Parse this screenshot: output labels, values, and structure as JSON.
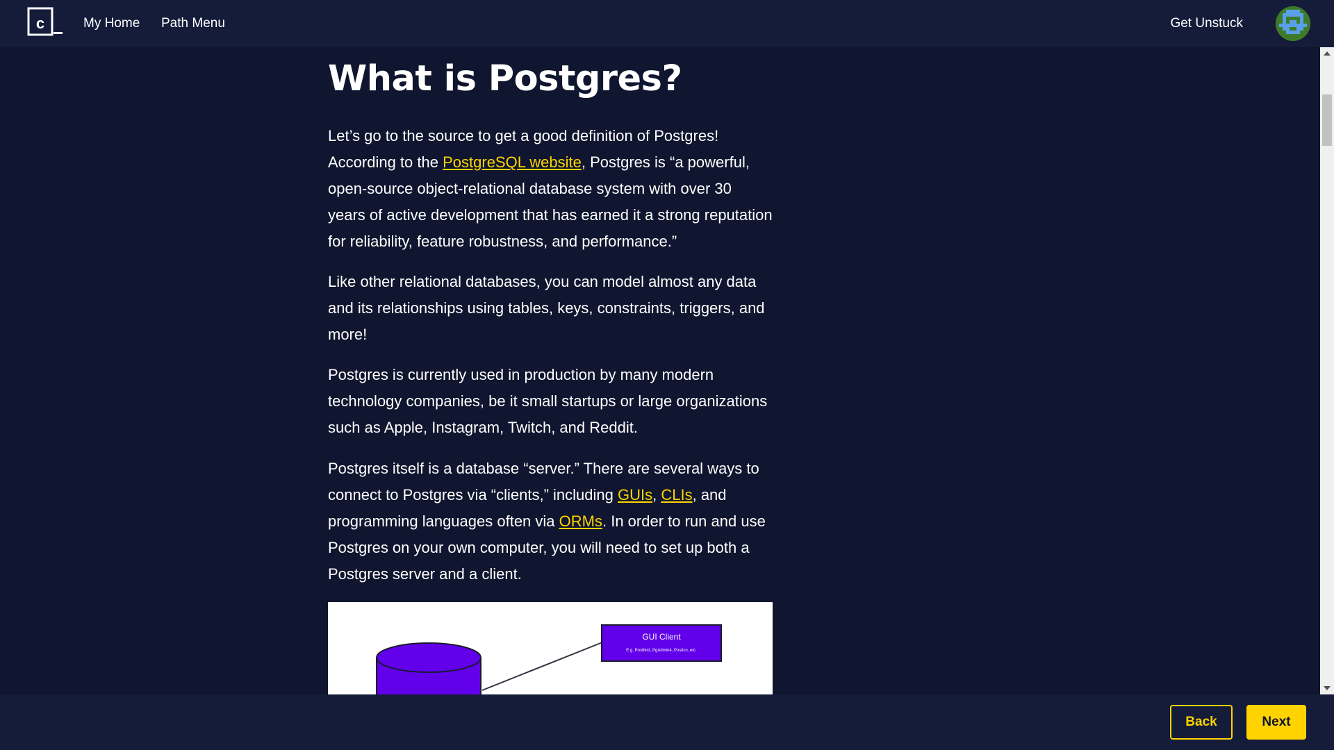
{
  "nav": {
    "logo_letter": "c",
    "my_home": "My Home",
    "path_menu": "Path Menu",
    "get_unstuck": "Get Unstuck"
  },
  "article": {
    "title": "What is Postgres?",
    "p1": {
      "a": "Let’s go to the source to get a good definition of Postgres! According to the ",
      "link": "PostgreSQL website",
      "b": ", Postgres is “a powerful, open-source object-relational database system with over 30 years of active development that has earned it a strong reputation for reliability, feature robustness, and performance.”"
    },
    "p2": "Like other relational databases, you can model almost any data and its relationships using tables, keys, constraints, triggers, and more!",
    "p3": "Postgres is currently used in production by many modern technology companies, be it small startups or large organizations such as Apple, Instagram, Twitch, and Reddit.",
    "p4": {
      "a": "Postgres itself is a database “server.” There are several ways to connect to Postgres via “clients,” including ",
      "link_guis": "GUIs",
      "sep1": ", ",
      "link_clis": "CLIs",
      "b": ", and programming languages often via ",
      "link_orms": "ORMs",
      "c": ". In order to run and use Postgres on your own computer, you will need to set up both a Postgres server and a client."
    },
    "diagram": {
      "gui_client_title": "GUI Client",
      "gui_client_sub": "E.g. Postbird, PgAdmin4, Postico, etc.",
      "purple": "#6200ea"
    }
  },
  "footer": {
    "back": "Back",
    "next": "Next"
  },
  "colors": {
    "background": "#10162f",
    "bar": "#141c3a",
    "accent": "#ffd300"
  }
}
